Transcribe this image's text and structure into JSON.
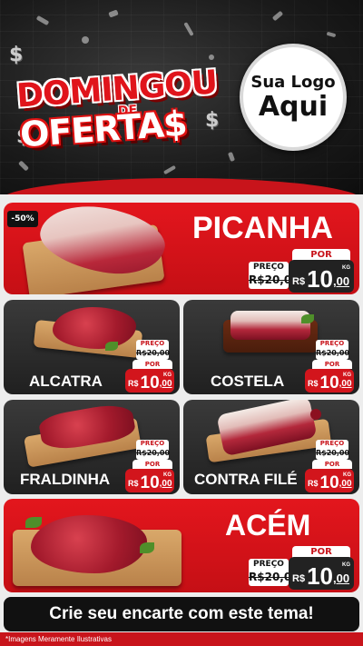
{
  "hero": {
    "title_line1": "DOMINGOU",
    "title_de": "DE",
    "title_line2": "OFERTA$",
    "dollar_sign": "$",
    "logo_line1": "Sua Logo",
    "logo_line2": "Aqui"
  },
  "featured_top": {
    "name": "PICANHA",
    "discount_badge": "-50%",
    "preco_label": "PREÇO",
    "old_price": "R$20,00",
    "por_label": "POR",
    "currency": "R$",
    "price_int": "10",
    "price_dec": ",00",
    "unit": "KG"
  },
  "grid": [
    {
      "name": "ALCATRA",
      "preco_label": "PREÇO",
      "old_price": "R$20,00",
      "por_label": "POR",
      "currency": "R$",
      "price_int": "10",
      "price_dec": ",00",
      "unit": "KG"
    },
    {
      "name": "COSTELA",
      "preco_label": "PREÇO",
      "old_price": "R$20,00",
      "por_label": "POR",
      "currency": "R$",
      "price_int": "10",
      "price_dec": ",00",
      "unit": "KG"
    },
    {
      "name": "FRALDINHA",
      "preco_label": "PREÇO",
      "old_price": "R$20,00",
      "por_label": "POR",
      "currency": "R$",
      "price_int": "10",
      "price_dec": ",00",
      "unit": "KG"
    },
    {
      "name": "CONTRA FILÉ",
      "preco_label": "PREÇO",
      "old_price": "R$20,00",
      "por_label": "POR",
      "currency": "R$",
      "price_int": "10",
      "price_dec": ",00",
      "unit": "KG"
    }
  ],
  "featured_bottom": {
    "name": "ACÉM",
    "preco_label": "PREÇO",
    "old_price": "R$20,00",
    "por_label": "POR",
    "currency": "R$",
    "price_int": "10",
    "price_dec": ",00",
    "unit": "KG"
  },
  "cta": {
    "label": "Crie seu encarte com este tema!"
  },
  "footnote": "*Imagens Meramente Ilustrativas",
  "colors": {
    "brand_red": "#c8141b",
    "dark_card": "#2b2b2b",
    "background": "#ededed"
  }
}
